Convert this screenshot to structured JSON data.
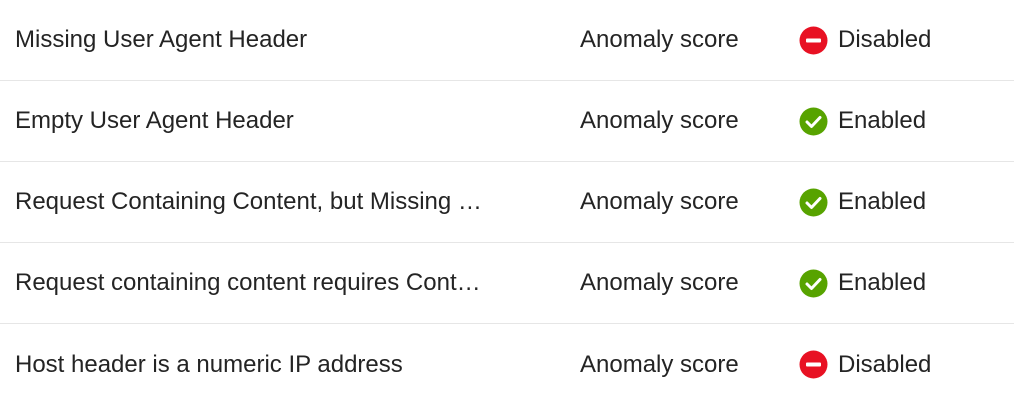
{
  "rules": [
    {
      "name": "Missing User Agent Header",
      "action": "Anomaly score",
      "status": "Disabled",
      "status_icon": "disabled-icon",
      "status_color": "#e81123"
    },
    {
      "name": "Empty User Agent Header",
      "action": "Anomaly score",
      "status": "Enabled",
      "status_icon": "enabled-check-icon",
      "status_color": "#57a300"
    },
    {
      "name": "Request Containing Content, but Missing …",
      "action": "Anomaly score",
      "status": "Enabled",
      "status_icon": "enabled-check-icon",
      "status_color": "#57a300"
    },
    {
      "name": "Request containing content requires Cont…",
      "action": "Anomaly score",
      "status": "Enabled",
      "status_icon": "enabled-check-icon",
      "status_color": "#57a300"
    },
    {
      "name": "Host header is a numeric IP address",
      "action": "Anomaly score",
      "status": "Disabled",
      "status_icon": "disabled-icon",
      "status_color": "#e81123"
    }
  ]
}
